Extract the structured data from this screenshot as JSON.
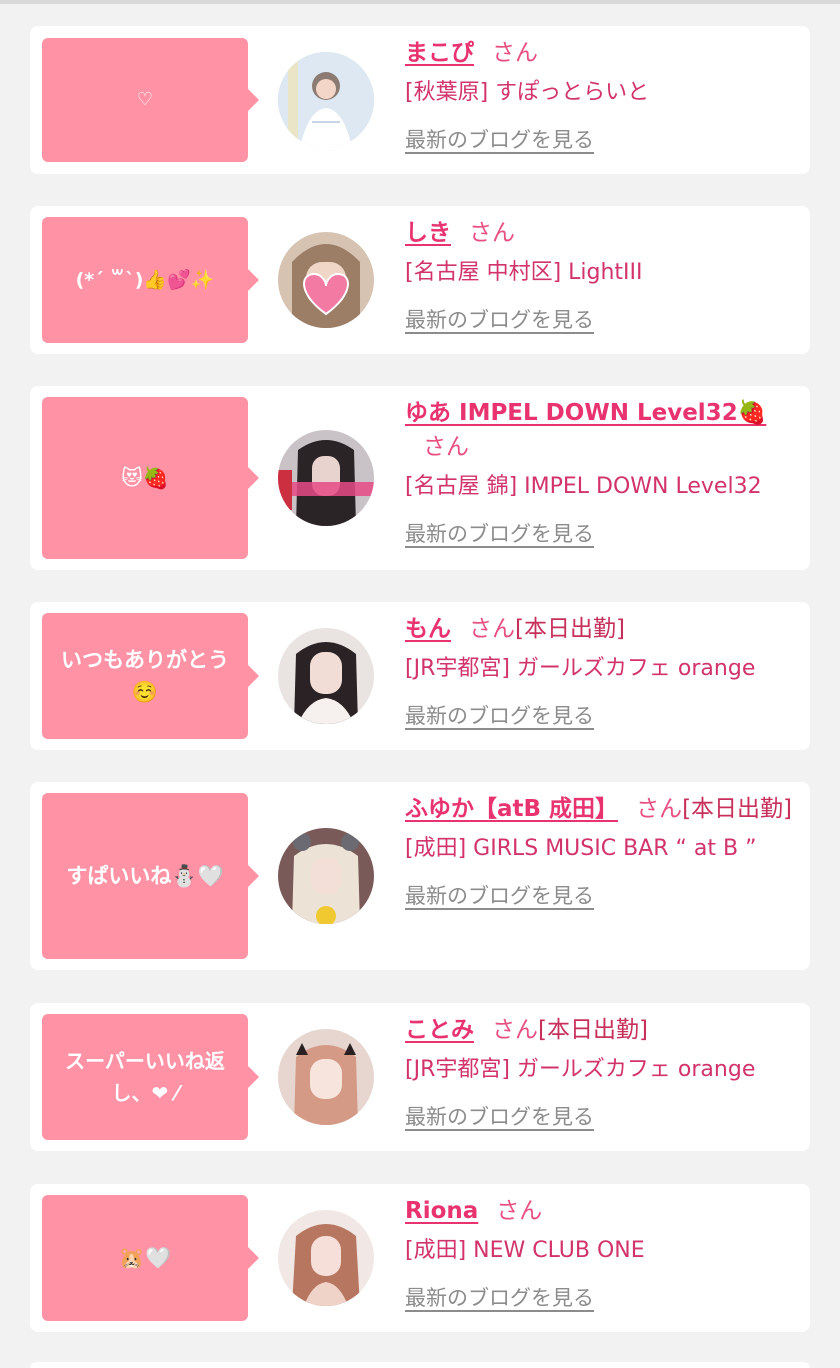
{
  "link_label": "最新のブログを見る",
  "honorific": "さん",
  "entries": [
    {
      "message": "♡",
      "name": "まこぴ",
      "status": "",
      "shop": "[秋葉原] すぽっとらいと"
    },
    {
      "message": "(*´ ꒳`)👍💕✨",
      "name": "しき",
      "status": "",
      "shop": "[名古屋 中村区] LightIII"
    },
    {
      "message": "😻🍓",
      "name": "ゆあ IMPEL DOWN Level32🍓",
      "status": "",
      "shop": "[名古屋 錦] IMPEL DOWN Level32"
    },
    {
      "message": "いつもありがとう☺️",
      "name": "もん",
      "status": "[本日出勤]",
      "shop": "[JR宇都宮] ガールズカフェ orange"
    },
    {
      "message": "すぱいいね⛄️🤍",
      "name": "ふゆか【atB 成田】",
      "status": "[本日出勤]",
      "shop": "[成田] GIRLS MUSIC BAR “ at B ”"
    },
    {
      "message": "スーパーいいね返し、❤︎ ⁄",
      "name": "ことみ",
      "status": "[本日出勤]",
      "shop": "[JR宇都宮] ガールズカフェ orange"
    },
    {
      "message": "🐹🤍",
      "name": "Riona",
      "status": "",
      "shop": "[成田] NEW CLUB ONE"
    }
  ]
}
